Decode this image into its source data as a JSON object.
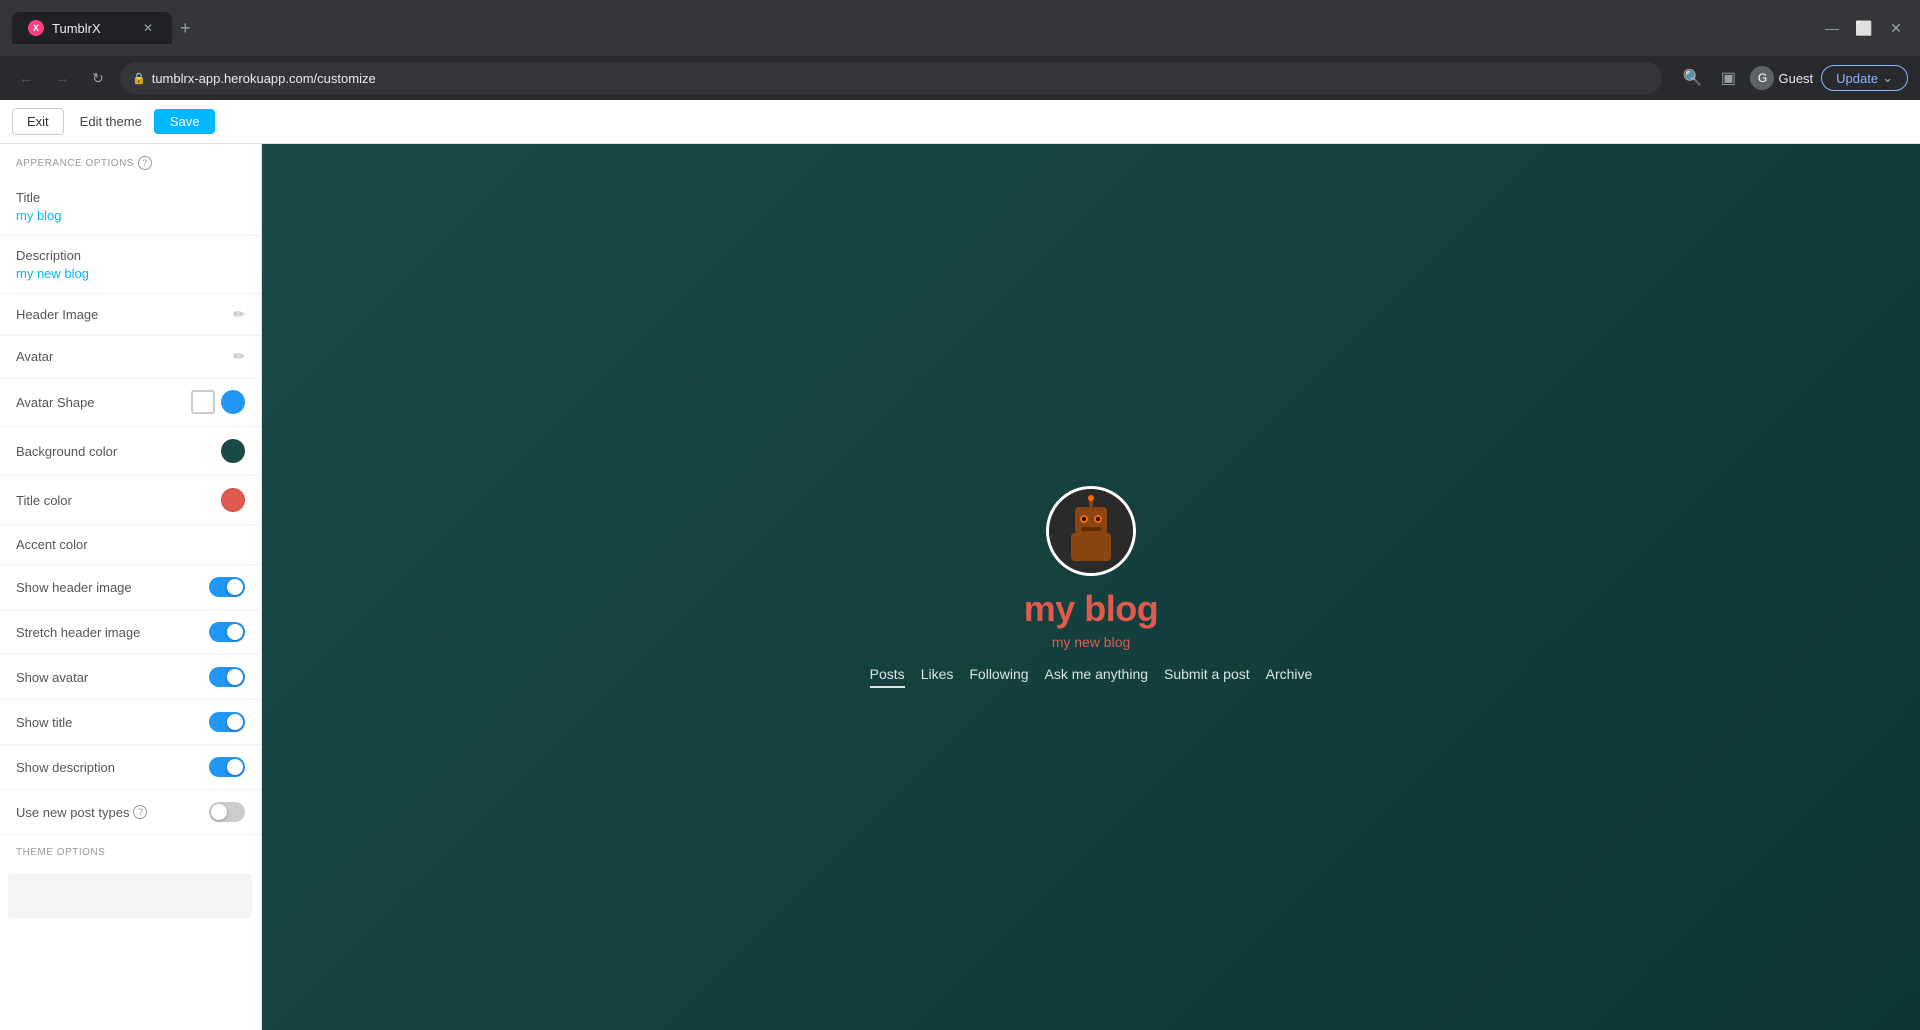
{
  "browser": {
    "tab_title": "TumblrX",
    "url": "tumblrx-app.herokuapp.com/customize",
    "new_tab_tooltip": "+",
    "profile_name": "Guest",
    "update_label": "Update"
  },
  "toolbar": {
    "exit_label": "Exit",
    "edit_theme_label": "Edit theme",
    "save_label": "Save"
  },
  "sidebar": {
    "section_label": "APPERANCE OPTIONS",
    "title_label": "Title",
    "title_value": "my blog",
    "description_label": "Description",
    "description_value": "my new blog",
    "header_image_label": "Header Image",
    "avatar_label": "Avatar",
    "avatar_shape_label": "Avatar Shape",
    "background_color_label": "Background color",
    "background_color_hex": "#1a4a47",
    "title_color_label": "Title color",
    "title_color_hex": "#e05a4e",
    "accent_color_label": "Accent color",
    "show_header_image_label": "Show header image",
    "show_header_image_on": true,
    "stretch_header_image_label": "Stretch header image",
    "stretch_header_image_on": true,
    "show_avatar_label": "Show avatar",
    "show_avatar_on": true,
    "show_title_label": "Show title",
    "show_title_on": true,
    "show_description_label": "Show description",
    "show_description_on": true,
    "use_new_post_types_label": "Use new post types",
    "use_new_post_types_on": false,
    "theme_options_label": "THEME OPTIONS"
  },
  "preview": {
    "blog_title": "my blog",
    "blog_description": "my new blog",
    "nav_items": [
      "Posts",
      "Likes",
      "Following",
      "Ask me anything",
      "Submit a post",
      "Archive"
    ],
    "active_nav": "Posts"
  }
}
